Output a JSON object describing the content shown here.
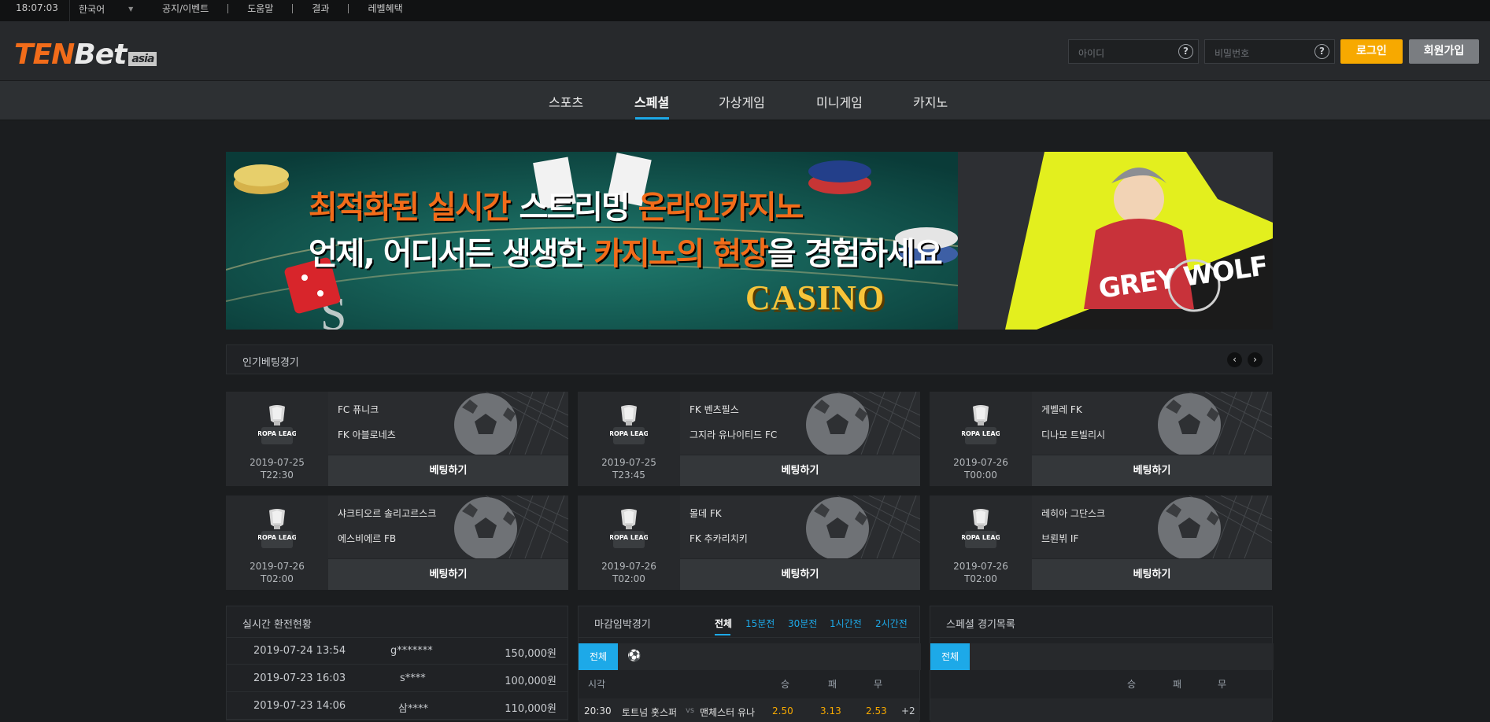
{
  "topbar": {
    "time": "18:07:03",
    "language": "한국어",
    "links": [
      "공지/이벤트",
      "도움말",
      "결과",
      "레벨혜택"
    ]
  },
  "header": {
    "logo_ten": "TEN",
    "logo_bet": "Bet",
    "logo_asia": "asia",
    "id_placeholder": "아이디",
    "pw_placeholder": "비밀번호",
    "help_glyph": "?",
    "login_label": "로그인",
    "join_label": "회원가입"
  },
  "nav": {
    "items": [
      "스포츠",
      "스페셜",
      "가상게임",
      "미니게임",
      "카지노"
    ],
    "active": "스페셜"
  },
  "banner": {
    "line1_a": "최적화된 ",
    "line1_b": "실시간",
    "line1_c": " 스트리밍 ",
    "line1_d": "온라인카지노",
    "line2_a": "언제, 어디서든 생생한 ",
    "line2_b": "카지노의 현장",
    "line2_c": "을 경험하세요",
    "casino_word": "CASINO",
    "side_title": "GREY WOLF"
  },
  "popular": {
    "title": "인기베팅경기",
    "prev_icon": "‹",
    "next_icon": "›",
    "league_text": "EUROPA LEAGUE",
    "bet_label": "베팅하기",
    "matches": [
      {
        "home": "FC 퓨니크",
        "away": "FK 아블로네츠",
        "date": "2019-07-25",
        "time": "T22:30"
      },
      {
        "home": "FK 벤츠필스",
        "away": "그지라 유나이티드 FC",
        "date": "2019-07-25",
        "time": "T23:45"
      },
      {
        "home": "게벨레 FK",
        "away": "디나모 트빌리시",
        "date": "2019-07-26",
        "time": "T00:00"
      },
      {
        "home": "샤크티오르 솔리고르스크",
        "away": "에스비에르 FB",
        "date": "2019-07-26",
        "time": "T02:00"
      },
      {
        "home": "몰데 FK",
        "away": "FK 추카리치키",
        "date": "2019-07-26",
        "time": "T02:00"
      },
      {
        "home": "레히아 그단스크",
        "away": "브뢴뷔 IF",
        "date": "2019-07-26",
        "time": "T02:00"
      }
    ]
  },
  "exchange": {
    "title": "실시간 환전현황",
    "rows": [
      {
        "datetime": "2019-07-24 13:54",
        "user": "g*******",
        "amount": "150,000원"
      },
      {
        "datetime": "2019-07-23 16:03",
        "user": "s****",
        "amount": "100,000원"
      },
      {
        "datetime": "2019-07-23 14:06",
        "user": "삼****",
        "amount": "110,000원"
      }
    ]
  },
  "closing": {
    "title": "마감임박경기",
    "filters": [
      "전체",
      "15분전",
      "30분전",
      "1시간전",
      "2시간전"
    ],
    "active_filter": "전체",
    "sub_all": "전체",
    "ball_icon": "⚽",
    "col_time": "시각",
    "col_win": "승",
    "col_lose": "패",
    "col_draw": "무",
    "rows": [
      {
        "time": "20:30",
        "home": "토트넘 홋스퍼",
        "vs": "vs",
        "away": "맨체스터 유나",
        "win": "2.50",
        "lose": "3.13",
        "draw": "2.53",
        "more": "+2"
      }
    ]
  },
  "special_list": {
    "title": "스페셜 경기목록",
    "sub_all": "전체",
    "col_win": "승",
    "col_lose": "패",
    "col_draw": "무"
  },
  "colors": {
    "accent_blue": "#1da9e8",
    "accent_orange": "#f7a900",
    "brand_orange": "#f26c1a"
  }
}
